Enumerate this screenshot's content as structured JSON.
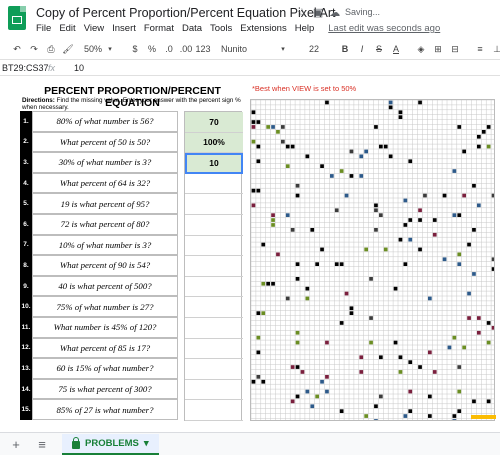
{
  "window": {
    "title": "Copy of Percent Proportion/Percent Equation Pixel Art",
    "saving_text": "Saving...",
    "last_edit": "Last edit was seconds ago"
  },
  "menu": [
    "File",
    "Edit",
    "View",
    "Insert",
    "Format",
    "Data",
    "Tools",
    "Extensions",
    "Help"
  ],
  "toolbar": {
    "zoom": "50%",
    "currency": "$",
    "percent": "%",
    "decimal_less": ".0",
    "decimal_more": ".00",
    "format_more": "123",
    "font": "Nunito",
    "font_size": "22",
    "bold": "B",
    "italic": "I",
    "strike": "S",
    "text_color": "A"
  },
  "formula_bar": {
    "name_box": "BT29:CS37",
    "fx": "fx",
    "value": "10"
  },
  "sheet": {
    "heading": "PERCENT PROPORTION/PERCENT EQUATION",
    "note": "*Best when VIEW is set to 50%",
    "directions_label": "Directions:",
    "directions_text": "Find the missing value. Enter your answer with the percent sign % when necessary.",
    "questions": [
      {
        "num": "1.",
        "text": "80% of what number is 56?",
        "answer": "70"
      },
      {
        "num": "2.",
        "text": "What percent of 50 is 50?",
        "answer": "100%"
      },
      {
        "num": "3.",
        "text": "30% of what number is 3?",
        "answer": "10"
      },
      {
        "num": "4.",
        "text": "What percent of 64 is 32?",
        "answer": ""
      },
      {
        "num": "5.",
        "text": "19 is what percent of 95?",
        "answer": ""
      },
      {
        "num": "6.",
        "text": "72 is what percent of 80?",
        "answer": ""
      },
      {
        "num": "7.",
        "text": "10% of what number is 3?",
        "answer": ""
      },
      {
        "num": "8.",
        "text": "What percent of 90 is 54?",
        "answer": ""
      },
      {
        "num": "9.",
        "text": "40 is what percent of 500?",
        "answer": ""
      },
      {
        "num": "10.",
        "text": "75% of what number is 27?",
        "answer": ""
      },
      {
        "num": "11.",
        "text": "What number is 45% of 120?",
        "answer": ""
      },
      {
        "num": "12.",
        "text": "What percent of 85 is 17?",
        "answer": ""
      },
      {
        "num": "13.",
        "text": "60 is 15% of what number?",
        "answer": ""
      },
      {
        "num": "14.",
        "text": "75 is what percent of 300?",
        "answer": ""
      },
      {
        "num": "15.",
        "text": "85% of 27 is what number?",
        "answer": ""
      }
    ]
  },
  "tabs": {
    "add": "+",
    "all_sheets": "≡",
    "active": "PROBLEMS",
    "active_caret": "▾"
  },
  "colors": {
    "answer_fill": "#d9ead3",
    "selection": "#4285f4",
    "note_red": "#d93025",
    "tab_green": "#188038"
  }
}
